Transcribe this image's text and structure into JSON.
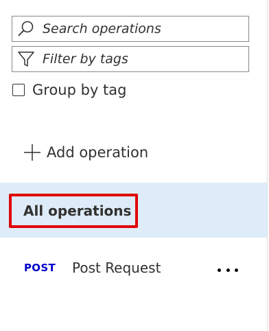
{
  "search": {
    "placeholder": "Search operations",
    "icon": "search-icon"
  },
  "filter": {
    "placeholder": "Filter by tags",
    "icon": "filter-icon"
  },
  "group_by_tag": {
    "label": "Group by tag",
    "checked": false
  },
  "add_operation": {
    "label": "Add operation",
    "icon": "plus-icon"
  },
  "all_operations": {
    "label": "All operations",
    "highlight_color": "#e00000",
    "background": "#deecf9"
  },
  "operations": [
    {
      "method": "POST",
      "method_color": "#0000cc",
      "name": "Post Request",
      "more_icon": "more-icon"
    }
  ]
}
